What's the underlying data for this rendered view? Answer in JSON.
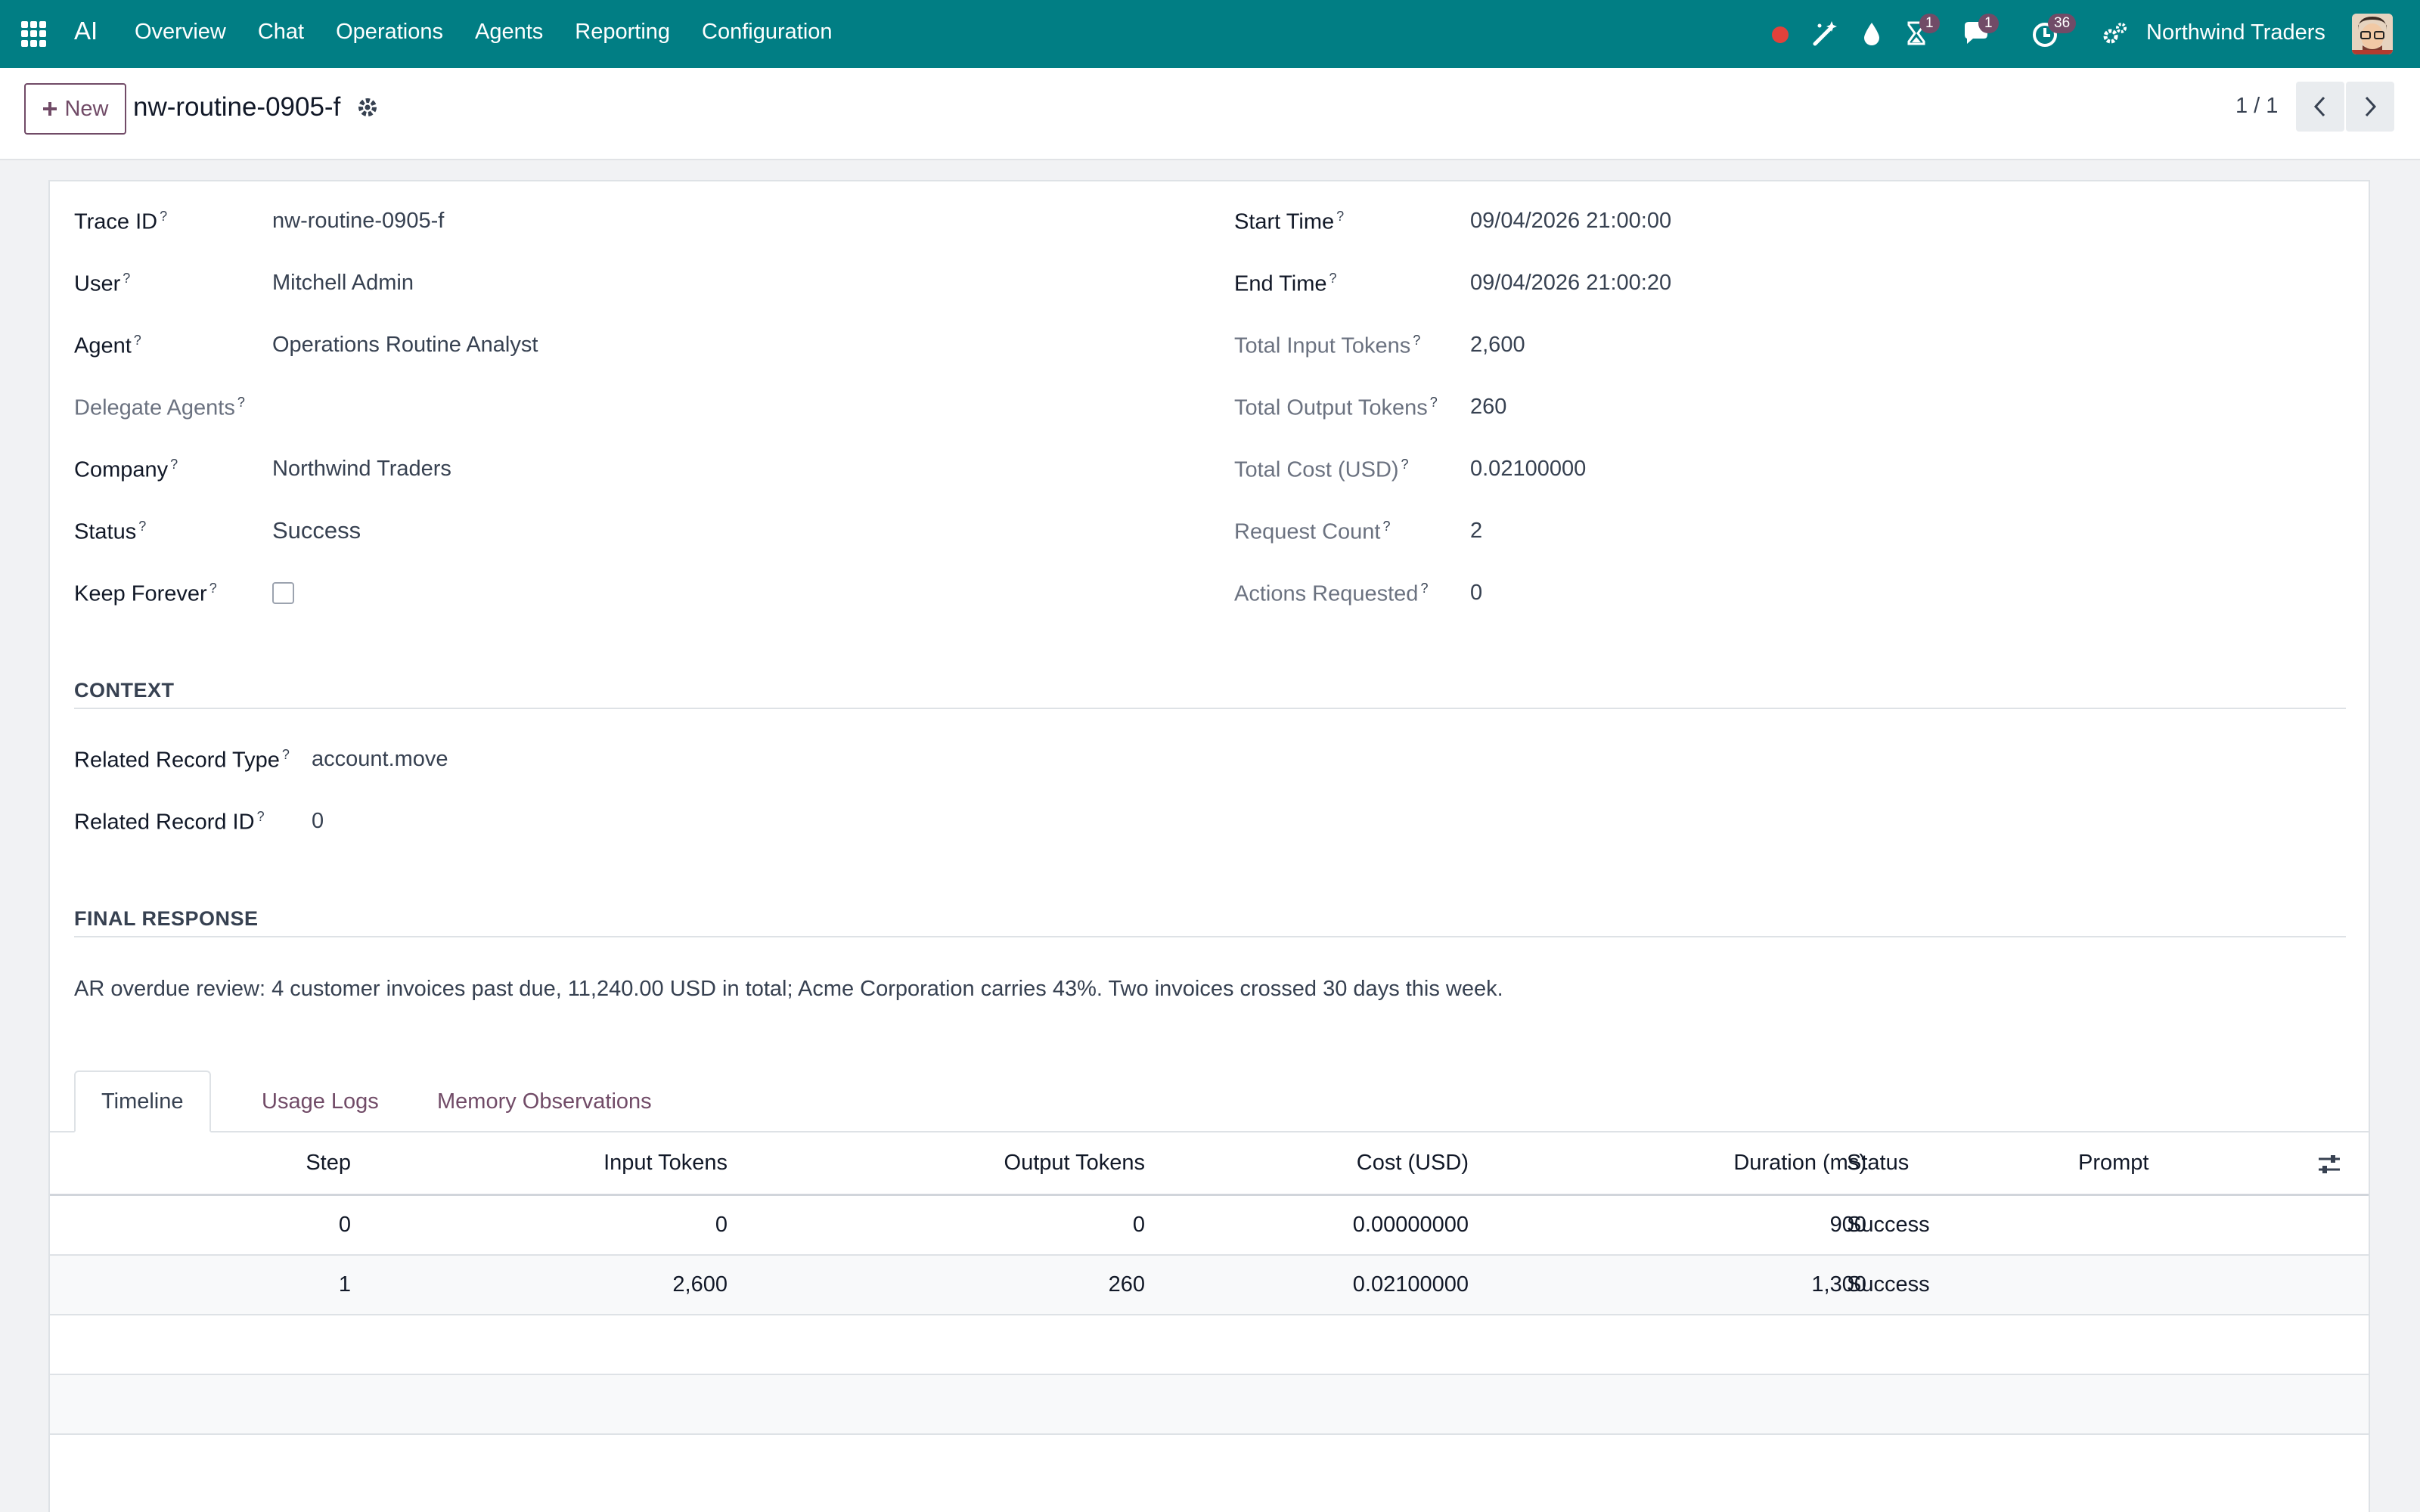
{
  "navbar": {
    "brand": "AI",
    "menu": [
      "Overview",
      "Chat",
      "Operations",
      "Agents",
      "Reporting",
      "Configuration"
    ],
    "badges": {
      "activity": "1",
      "messages": "1",
      "clock": "36"
    },
    "company": "Northwind Traders",
    "icons": [
      "record-dot-icon",
      "magic-wand-icon",
      "drop-icon",
      "hourglass-icon",
      "chat-icon",
      "clock-icon",
      "settings-icon"
    ],
    "colors": {
      "bar": "#017e84",
      "badge": "#714b67",
      "recording_dot": "#e2413b"
    }
  },
  "control": {
    "new_label": "New",
    "record_title": "nw-routine-0905-f",
    "pager": "1 / 1"
  },
  "left_fields": [
    {
      "label": "Trace ID",
      "value": "nw-routine-0905-f"
    },
    {
      "label": "User",
      "value": "Mitchell Admin"
    },
    {
      "label": "Agent",
      "value": "Operations Routine Analyst"
    },
    {
      "label": "Delegate Agents",
      "value": ""
    },
    {
      "label": "Company",
      "value": "Northwind Traders"
    },
    {
      "label": "Status",
      "value": "Success"
    },
    {
      "label": "Keep Forever",
      "value": ""
    }
  ],
  "right_fields": [
    {
      "label": "Start Time",
      "value": "09/04/2026 21:00:00"
    },
    {
      "label": "End Time",
      "value": "09/04/2026 21:00:20"
    },
    {
      "label": "Total Input Tokens",
      "value": "2,600"
    },
    {
      "label": "Total Output Tokens",
      "value": "260"
    },
    {
      "label": "Total Cost (USD)",
      "value": "0.02100000"
    },
    {
      "label": "Request Count",
      "value": "2"
    },
    {
      "label": "Actions Requested",
      "value": "0"
    }
  ],
  "help_mark": "?",
  "context": {
    "title": "CONTEXT",
    "fields": [
      {
        "label": "Related Record Type",
        "value": "account.move"
      },
      {
        "label": "Related Record ID",
        "value": "0"
      }
    ]
  },
  "final_response": {
    "title": "FINAL RESPONSE",
    "text": "AR overdue review: 4 customer invoices past due, 11,240.00 USD in total; Acme Corporation carries 43%. Two invoices crossed 30 days this week."
  },
  "tabs": [
    "Timeline",
    "Usage Logs",
    "Memory Observations"
  ],
  "table": {
    "headers": [
      "Step",
      "Input Tokens",
      "Output Tokens",
      "Cost (USD)",
      "Duration (ms)",
      "Status",
      "Prompt"
    ],
    "rows": [
      [
        "0",
        "0",
        "0",
        "0.00000000",
        "900",
        "Success",
        ""
      ],
      [
        "1",
        "2,600",
        "260",
        "0.02100000",
        "1,300",
        "Success",
        ""
      ]
    ]
  }
}
